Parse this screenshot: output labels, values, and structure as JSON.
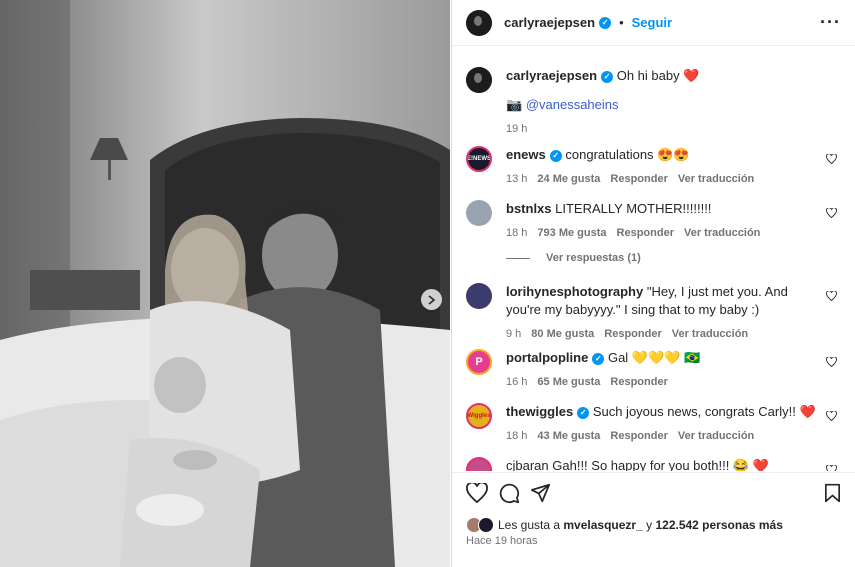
{
  "post": {
    "username": "carlyraejepsen",
    "follow": "Seguir",
    "more": "···",
    "dot": "•"
  },
  "caption": {
    "username": "carlyraejepsen",
    "text": "Oh hi baby ❤️",
    "credit_prefix": "📷",
    "credit": "@vanessaheins",
    "time": "19 h"
  },
  "comments": [
    {
      "user": "enews",
      "verified": true,
      "text": "congratulations 😍😍",
      "time": "13 h",
      "likes": "24 Me gusta",
      "reply": "Responder",
      "translate": "Ver traducción",
      "avatar_color": "#1a1a2e"
    },
    {
      "user": "bstnlxs",
      "verified": false,
      "text": "LITERALLY MOTHER!!!!!!!!",
      "time": "18 h",
      "likes": "793 Me gusta",
      "reply": "Responder",
      "translate": "Ver traducción",
      "avatar_color": "#9aa4b0"
    },
    {
      "user": "lorihynesphotography",
      "verified": false,
      "text": "\"Hey, I just met you. And you're my babyyyy.\" I sing that to my baby :)",
      "time": "9 h",
      "likes": "80 Me gusta",
      "reply": "Responder",
      "translate": "Ver traducción",
      "avatar_color": "#3b3b6d"
    },
    {
      "user": "portalpopline",
      "verified": true,
      "text": "Gal 💛💛💛 🇧🇷",
      "time": "16 h",
      "likes": "65 Me gusta",
      "reply": "Responder",
      "translate": "",
      "avatar_color": "#e63d8f"
    },
    {
      "user": "thewiggles",
      "verified": true,
      "text": "Such joyous news, congrats Carly!! ❤️",
      "time": "18 h",
      "likes": "43 Me gusta",
      "reply": "Responder",
      "translate": "Ver traducción",
      "avatar_color": "#e3b21a"
    },
    {
      "user": "cjbaran",
      "verified": false,
      "text": "Gah!!! So happy for you both!!! 😂 ❤️",
      "time": "",
      "likes": "",
      "reply": "",
      "translate": "",
      "avatar_color": "#c44d8a"
    }
  ],
  "view_replies": "Ver respuestas (1)",
  "likes": {
    "prefix": "Les gusta a",
    "user": "mvelasquezr_",
    "connector": "y",
    "count": "122.542 personas más"
  },
  "timestamp": "Hace 19 horas",
  "icons": {
    "like": "heart-icon",
    "comment": "comment-icon",
    "share": "share-icon",
    "save": "bookmark-icon",
    "next": "chevron-right-icon"
  }
}
